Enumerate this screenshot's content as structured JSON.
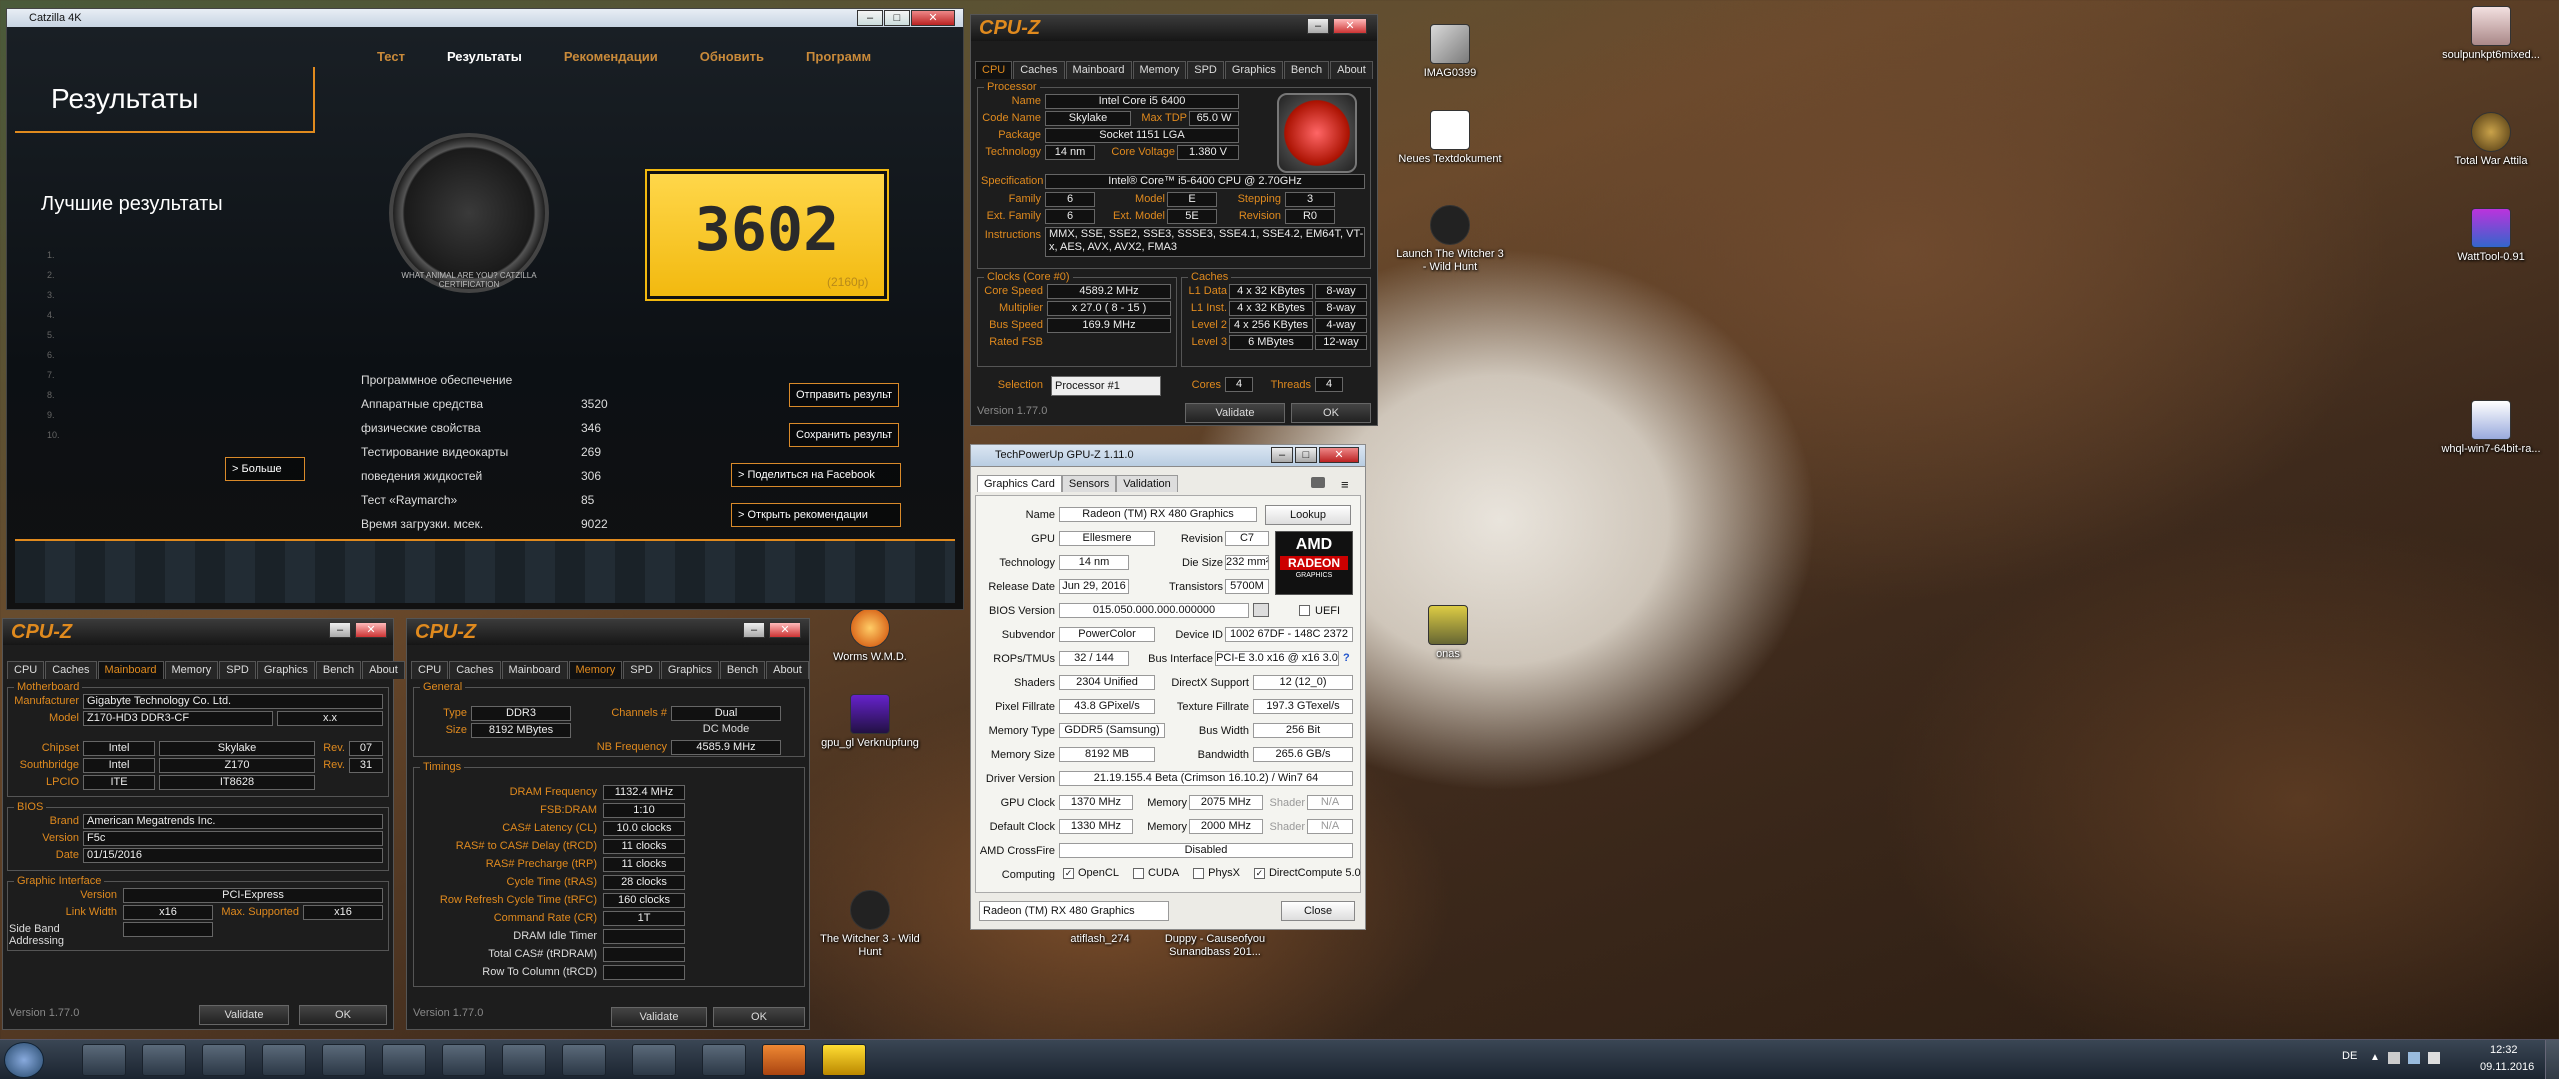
{
  "desktop": {
    "icons": [
      {
        "label": "IMAG0399"
      },
      {
        "label": "Neues Textdokument"
      },
      {
        "label": "Launch The Witcher 3 - Wild Hunt"
      },
      {
        "label": "soulpunkpt6mixed..."
      },
      {
        "label": "Total War Attila"
      },
      {
        "label": "WattTool-0.91"
      },
      {
        "label": "whql-win7-64bit-ra..."
      },
      {
        "label": "onas"
      },
      {
        "label": "Worms W.M.D."
      },
      {
        "label": "gpu_gl Verknüpfung"
      },
      {
        "label": "The Witcher 3 - Wild Hunt"
      },
      {
        "label": "atiflash_274"
      },
      {
        "label": "Duppy - Causeofyou Sunandbass 201..."
      }
    ]
  },
  "catzilla": {
    "title": "Catzilla 4K",
    "nav": [
      "Тест",
      "Результаты",
      "Рекомендации",
      "Обновить",
      "Программ"
    ],
    "heading": "Результаты",
    "best": "Лучшие результаты",
    "cert": "WHAT ANIMAL ARE YOU? CATZILLA CERTIFICATION",
    "score": "3602",
    "res": "(2160p)",
    "more": "> Больше",
    "list": [
      "1.",
      "2.",
      "3.",
      "4.",
      "5.",
      "6.",
      "7.",
      "8.",
      "9.",
      "10."
    ],
    "rows": [
      {
        "k": "Программное обеспечение",
        "v": ""
      },
      {
        "k": "Аппаратные средства",
        "v": "3520"
      },
      {
        "k": "физические свойства",
        "v": "346"
      },
      {
        "k": "Тестирование видеокарты",
        "v": "269"
      },
      {
        "k": "поведения жидкостей",
        "v": "306"
      },
      {
        "k": "Тест «Raymarch»",
        "v": "85"
      },
      {
        "k": "Время загрузки. мсек.",
        "v": "9022"
      }
    ],
    "btns": [
      "Отправить результ",
      "Сохранить результ",
      "> Поделиться на Facebook",
      "> Открыть рекомендации"
    ]
  },
  "cpuz_main": {
    "title": "CPU-Z",
    "tabs": [
      "CPU",
      "Caches",
      "Mainboard",
      "Memory",
      "SPD",
      "Graphics",
      "Bench",
      "About"
    ],
    "proc": "Processor",
    "name_l": "Name",
    "name": "Intel Core i5 6400",
    "code_l": "Code Name",
    "code": "Skylake",
    "tdp_l": "Max TDP",
    "tdp": "65.0 W",
    "pkg_l": "Package",
    "pkg": "Socket 1151 LGA",
    "tech_l": "Technology",
    "tech": "14 nm",
    "cv_l": "Core Voltage",
    "cv": "1.380 V",
    "spec_l": "Specification",
    "spec": "Intel® Core™ i5-6400 CPU @ 2.70GHz",
    "fam_l": "Family",
    "fam": "6",
    "mod_l": "Model",
    "mod": "E",
    "step_l": "Stepping",
    "step": "3",
    "efam_l": "Ext. Family",
    "efam": "6",
    "emod_l": "Ext. Model",
    "emod": "5E",
    "rev_l": "Revision",
    "rev": "R0",
    "ins_l": "Instructions",
    "ins": "MMX, SSE, SSE2, SSE3, SSSE3, SSE4.1, SSE4.2, EM64T, VT-x, AES, AVX, AVX2, FMA3",
    "clocks": "Clocks (Core #0)",
    "cs_l": "Core Speed",
    "cs": "4589.2 MHz",
    "mul_l": "Multiplier",
    "mul": "x 27.0 ( 8 - 15 )",
    "bus_l": "Bus Speed",
    "bus": "169.9 MHz",
    "fsb_l": "Rated FSB",
    "caches": "Caches",
    "l1d_l": "L1 Data",
    "l1d": "4 x 32 KBytes",
    "l1d_w": "8-way",
    "l1i_l": "L1 Inst.",
    "l1i": "4 x 32 KBytes",
    "l1i_w": "8-way",
    "l2_l": "Level 2",
    "l2": "4 x 256 KBytes",
    "l2_w": "4-way",
    "l3_l": "Level 3",
    "l3": "6 MBytes",
    "l3_w": "12-way",
    "sel_l": "Selection",
    "sel": "Processor #1",
    "cores_l": "Cores",
    "cores": "4",
    "thr_l": "Threads",
    "thr": "4",
    "ver": "Version 1.77.0",
    "validate": "Validate",
    "ok": "OK"
  },
  "cpuz_mb": {
    "title": "CPU-Z",
    "active": "Mainboard",
    "grp_mb": "Motherboard",
    "man_l": "Manufacturer",
    "man": "Gigabyte Technology Co. Ltd.",
    "model_l": "Model",
    "model": "Z170-HD3 DDR3-CF",
    "model2": "x.x",
    "chip_l": "Chipset",
    "chip": "Intel",
    "chip2": "Skylake",
    "rev_l": "Rev.",
    "chip_rev": "07",
    "south_l": "Southbridge",
    "south": "Intel",
    "south2": "Z170",
    "south_rev": "31",
    "lpc_l": "LPCIO",
    "lpc": "ITE",
    "lpc2": "IT8628",
    "grp_bios": "BIOS",
    "brand_l": "Brand",
    "brand": "American Megatrends Inc.",
    "bver_l": "Version",
    "bver": "F5c",
    "bdate_l": "Date",
    "bdate": "01/15/2016",
    "grp_gi": "Graphic Interface",
    "gver_l": "Version",
    "gver": "PCI-Express",
    "lw_l": "Link Width",
    "lw": "x16",
    "ms_l": "Max. Supported",
    "ms": "x16",
    "sba_l": "Side Band Addressing"
  },
  "cpuz_mem": {
    "title": "CPU-Z",
    "active": "Memory",
    "grp_gen": "General",
    "type_l": "Type",
    "type": "DDR3",
    "ch_l": "Channels #",
    "ch": "Dual",
    "size_l": "Size",
    "size": "8192 MBytes",
    "dc": "DC Mode",
    "nb_l": "NB Frequency",
    "nb": "4585.9 MHz",
    "grp_t": "Timings",
    "timings": [
      {
        "k": "DRAM Frequency",
        "v": "1132.4 MHz"
      },
      {
        "k": "FSB:DRAM",
        "v": "1:10"
      },
      {
        "k": "CAS# Latency (CL)",
        "v": "10.0 clocks"
      },
      {
        "k": "RAS# to CAS# Delay (tRCD)",
        "v": "11 clocks"
      },
      {
        "k": "RAS# Precharge (tRP)",
        "v": "11 clocks"
      },
      {
        "k": "Cycle Time (tRAS)",
        "v": "28 clocks"
      },
      {
        "k": "Row Refresh Cycle Time (tRFC)",
        "v": "160 clocks"
      },
      {
        "k": "Command Rate (CR)",
        "v": "1T"
      },
      {
        "k": "DRAM Idle Timer",
        "v": ""
      },
      {
        "k": "Total CAS# (tRDRAM)",
        "v": ""
      },
      {
        "k": "Row To Column (tRCD)",
        "v": ""
      }
    ]
  },
  "gpuz": {
    "title": "TechPowerUp GPU-Z 1.11.0",
    "tabs": [
      "Graphics Card",
      "Sensors",
      "Validation"
    ],
    "lookup": "Lookup",
    "fields": [
      {
        "k": "Name",
        "v": "Radeon (TM) RX 480 Graphics"
      },
      {
        "k": "GPU",
        "v": "Ellesmere",
        "k2": "Revision",
        "v2": "C7"
      },
      {
        "k": "Technology",
        "v": "14 nm",
        "k2": "Die Size",
        "v2": "232 mm²"
      },
      {
        "k": "Release Date",
        "v": "Jun 29, 2016",
        "k2": "Transistors",
        "v2": "5700M"
      },
      {
        "k": "BIOS Version",
        "v": "015.050.000.000.000000"
      },
      {
        "k": "Subvendor",
        "v": "PowerColor",
        "k2": "Device ID",
        "v2": "1002 67DF - 148C 2372"
      },
      {
        "k": "ROPs/TMUs",
        "v": "32 / 144",
        "k2": "Bus Interface",
        "v2": "PCI-E 3.0 x16 @ x16 3.0"
      },
      {
        "k": "Shaders",
        "v": "2304 Unified",
        "k2": "DirectX Support",
        "v2": "12 (12_0)"
      },
      {
        "k": "Pixel Fillrate",
        "v": "43.8 GPixel/s",
        "k2": "Texture Fillrate",
        "v2": "197.3 GTexel/s"
      },
      {
        "k": "Memory Type",
        "v": "GDDR5 (Samsung)",
        "k2": "Bus Width",
        "v2": "256 Bit"
      },
      {
        "k": "Memory Size",
        "v": "8192 MB",
        "k2": "Bandwidth",
        "v2": "265.6 GB/s"
      },
      {
        "k": "Driver Version",
        "v": "21.19.155.4 Beta (Crimson 16.10.2) / Win7 64"
      },
      {
        "k": "GPU Clock",
        "v": "1370 MHz",
        "k2": "Memory",
        "v2": "2075 MHz",
        "k3": "Shader",
        "v3": "N/A"
      },
      {
        "k": "Default Clock",
        "v": "1330 MHz",
        "k2": "Memory",
        "v2": "2000 MHz",
        "k3": "Shader",
        "v3": "N/A"
      },
      {
        "k": "AMD CrossFire",
        "v": "Disabled"
      }
    ],
    "uefi": "UEFI",
    "computing": "Computing",
    "opencl": "OpenCL",
    "cuda": "CUDA",
    "physx": "PhysX",
    "dc": "DirectCompute 5.0",
    "select": "Radeon (TM) RX 480 Graphics",
    "close": "Close",
    "amd": "AMD",
    "radeon": "RADEON",
    "graphics": "GRAPHICS"
  },
  "taskbar": {
    "lang": "DE",
    "time": "12:32",
    "date": "09.11.2016"
  }
}
